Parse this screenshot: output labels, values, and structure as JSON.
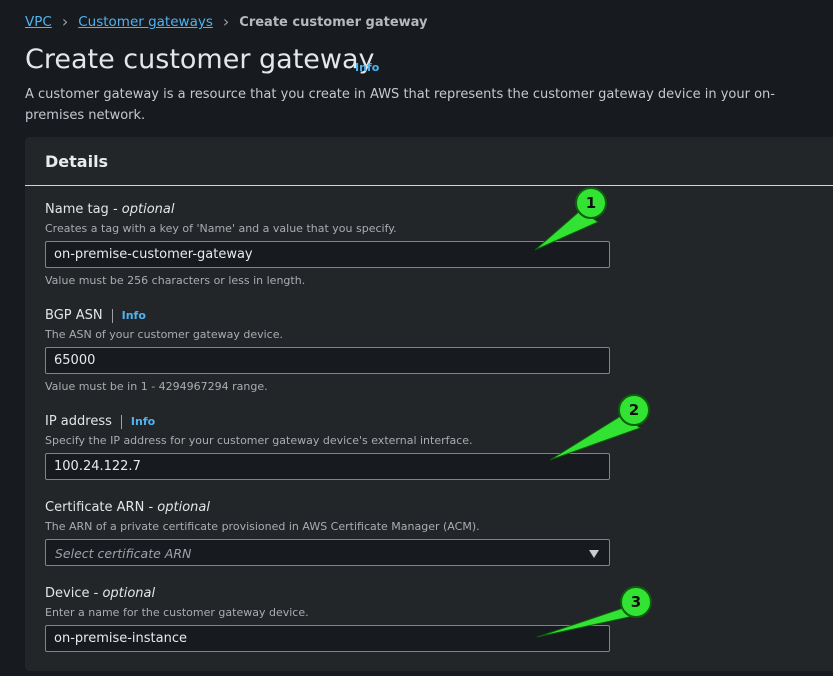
{
  "breadcrumb": {
    "items": [
      "VPC",
      "Customer gateways"
    ],
    "current": "Create customer gateway"
  },
  "page": {
    "title": "Create customer gateway",
    "info": "Info",
    "description": "A customer gateway is a resource that you create in AWS that represents the customer gateway device in your on-premises network."
  },
  "details": {
    "title": "Details",
    "name_tag": {
      "label": "Name tag",
      "optional": "optional",
      "description": "Creates a tag with a key of 'Name' and a value that you specify.",
      "value": "on-premise-customer-gateway",
      "constraint": "Value must be 256 characters or less in length."
    },
    "bgp_asn": {
      "label": "BGP ASN",
      "info": "Info",
      "description": "The ASN of your customer gateway device.",
      "value": "65000",
      "constraint": "Value must be in 1 - 4294967294 range."
    },
    "ip_address": {
      "label": "IP address",
      "info": "Info",
      "description": "Specify the IP address for your customer gateway device's external interface.",
      "value": "100.24.122.7"
    },
    "certificate_arn": {
      "label": "Certificate ARN",
      "optional": "optional",
      "description": "The ARN of a private certificate provisioned in AWS Certificate Manager (ACM).",
      "placeholder": "Select certificate ARN"
    },
    "device": {
      "label": "Device",
      "optional": "optional",
      "description": "Enter a name for the customer gateway device.",
      "value": "on-premise-instance"
    }
  },
  "callouts": [
    "1",
    "2",
    "3"
  ],
  "colors": {
    "background": "#171a1e",
    "panel": "#232629",
    "link": "#4fb3f0",
    "callout": "#33e333"
  }
}
